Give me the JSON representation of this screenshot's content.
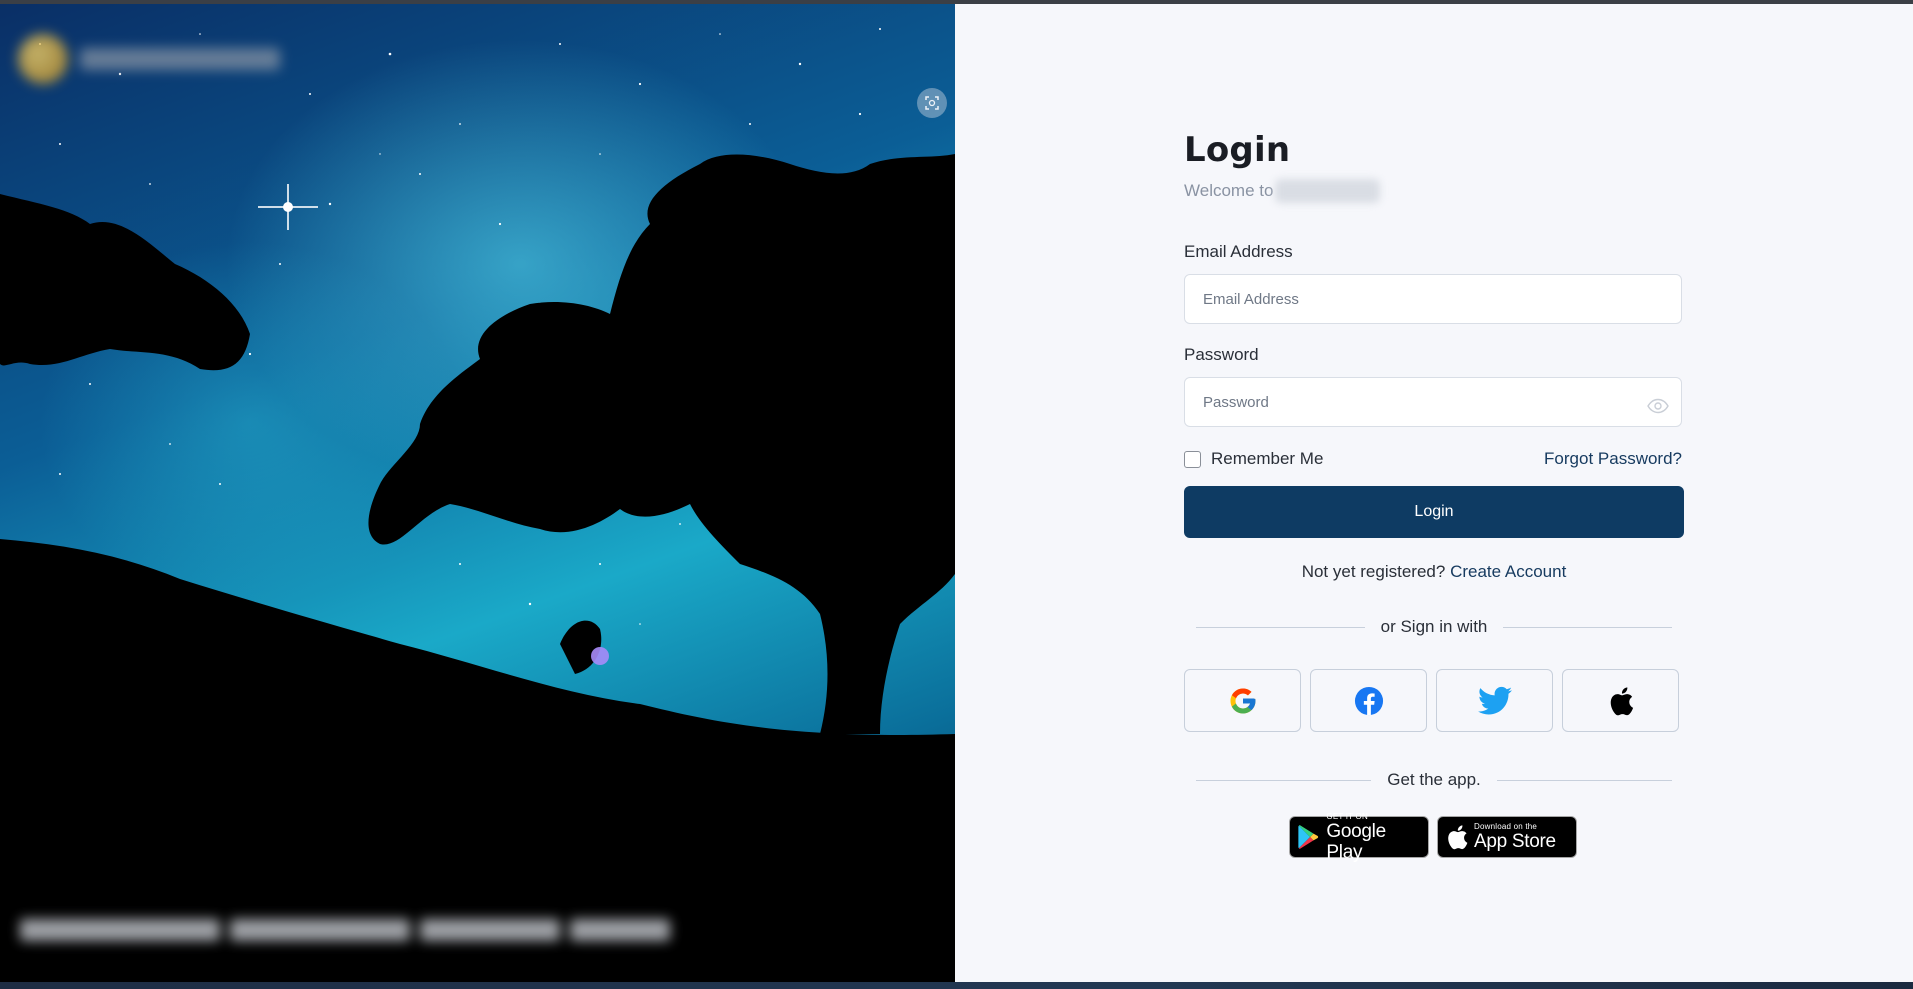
{
  "login": {
    "title": "Login",
    "welcome_prefix": "Welcome to",
    "email_label": "Email Address",
    "email_placeholder": "Email Address",
    "password_label": "Password",
    "password_placeholder": "Password",
    "remember_label": "Remember Me",
    "forgot_label": "Forgot Password?",
    "login_button": "Login",
    "not_registered": "Not yet registered?",
    "create_account": "Create Account",
    "signin_with": "or Sign in with",
    "get_app": "Get the app."
  },
  "social": [
    "google-icon",
    "facebook-icon",
    "twitter-icon",
    "apple-icon"
  ],
  "stores": {
    "google_small": "GET IT ON",
    "google_big": "Google Play",
    "apple_small": "Download on the",
    "apple_big": "App Store"
  },
  "colors": {
    "primary": "#0e3b63",
    "link": "#163a5f",
    "panel_bg": "#f6f7fb"
  }
}
